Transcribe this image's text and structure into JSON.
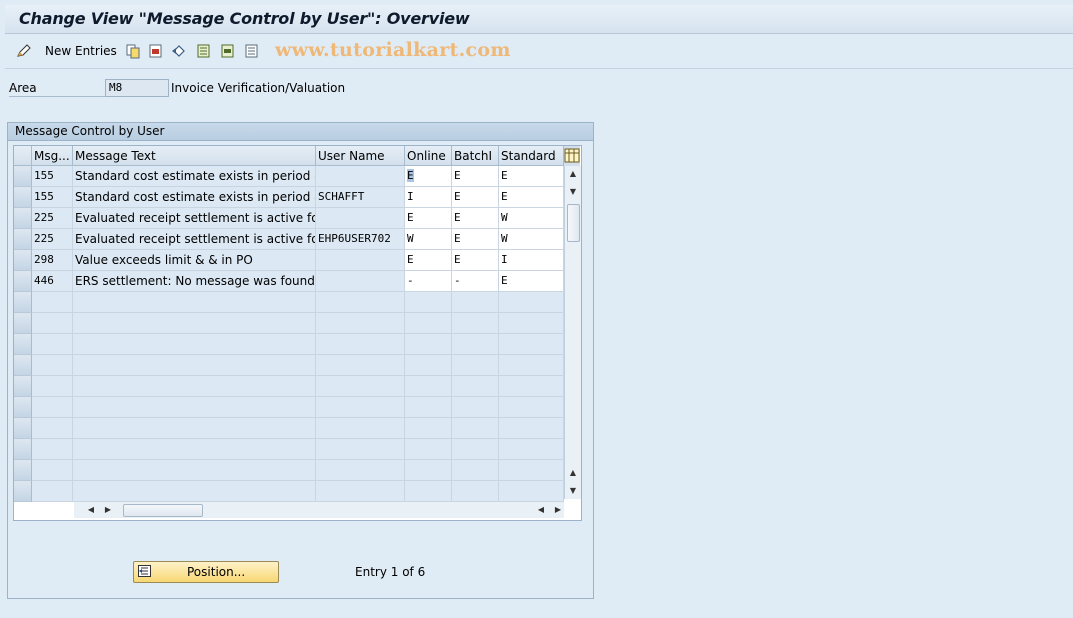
{
  "title": "Change View \"Message Control by User\": Overview",
  "toolbar": {
    "new_entries": "New Entries",
    "watermark": "www.tutorialkart.com",
    "icons": [
      "edit-pencil-icon",
      "copy-icon",
      "delete-icon",
      "undo-icon",
      "select-all-icon",
      "select-block-icon",
      "deselect-all-icon"
    ]
  },
  "area": {
    "label": "Area",
    "value": "M8",
    "description": "Invoice Verification/Valuation"
  },
  "panel": {
    "title": "Message Control by User"
  },
  "table": {
    "columns": [
      "Msg...",
      "Message Text",
      "User Name",
      "Online",
      "BatchI",
      "Standard"
    ],
    "rows": [
      {
        "msg": "155",
        "text": "Standard cost estimate exists in period & &",
        "user": "",
        "online": "E",
        "batch": "E",
        "standard": "E"
      },
      {
        "msg": "155",
        "text": "Standard cost estimate exists in period & &",
        "user": "SCHAFFT",
        "online": "I",
        "batch": "E",
        "standard": "E"
      },
      {
        "msg": "225",
        "text": "Evaluated receipt settlement is active for p...",
        "user": "",
        "online": "E",
        "batch": "E",
        "standard": "W"
      },
      {
        "msg": "225",
        "text": "Evaluated receipt settlement is active for p...",
        "user": "EHP6USER702",
        "online": "W",
        "batch": "E",
        "standard": "W"
      },
      {
        "msg": "298",
        "text": "Value exceeds limit & & in PO",
        "user": "",
        "online": "E",
        "batch": "E",
        "standard": "I"
      },
      {
        "msg": "446",
        "text": "ERS settlement: No message was found fo...",
        "user": "",
        "online": "-",
        "batch": "-",
        "standard": "E"
      }
    ]
  },
  "footer": {
    "position_button": "Position...",
    "entry_text": "Entry 1 of 6"
  },
  "colors": {
    "background": "#dfebf5",
    "button": "#f7d774",
    "watermark": "#efb877"
  }
}
